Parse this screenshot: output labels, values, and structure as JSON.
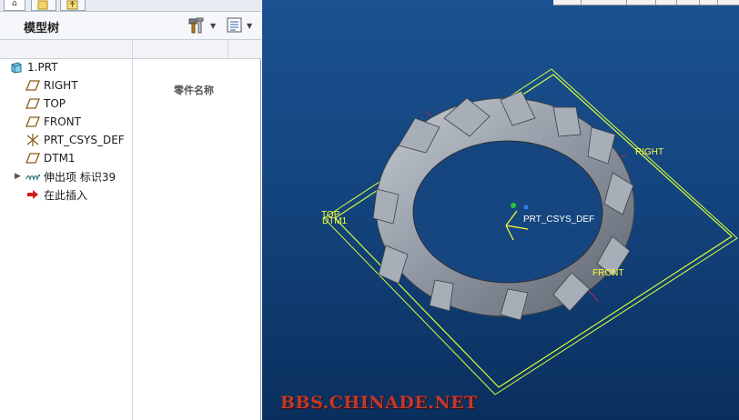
{
  "model_tree": {
    "title": "模型树",
    "column_header": "零件名称",
    "items": [
      {
        "label": "1.PRT",
        "icon": "part-icon"
      },
      {
        "label": "RIGHT",
        "icon": "datum-plane-icon"
      },
      {
        "label": "TOP",
        "icon": "datum-plane-icon"
      },
      {
        "label": "FRONT",
        "icon": "datum-plane-icon"
      },
      {
        "label": "PRT_CSYS_DEF",
        "icon": "coordinate-system-icon"
      },
      {
        "label": "DTM1",
        "icon": "datum-plane-icon"
      },
      {
        "label": "伸出项 标识39",
        "icon": "protrusion-icon"
      },
      {
        "label": "在此插入",
        "icon": "insert-here-arrow-icon"
      }
    ]
  },
  "viewport": {
    "labels": {
      "right": "RIGHT",
      "top": "TOP",
      "dtm1": "DTM1",
      "front": "FRONT",
      "csys": "PRT_CSYS_DEF"
    },
    "background_color": "#13437c",
    "datum_color": "#ffff3a"
  },
  "watermark": "BBS.CHINADE.NET"
}
